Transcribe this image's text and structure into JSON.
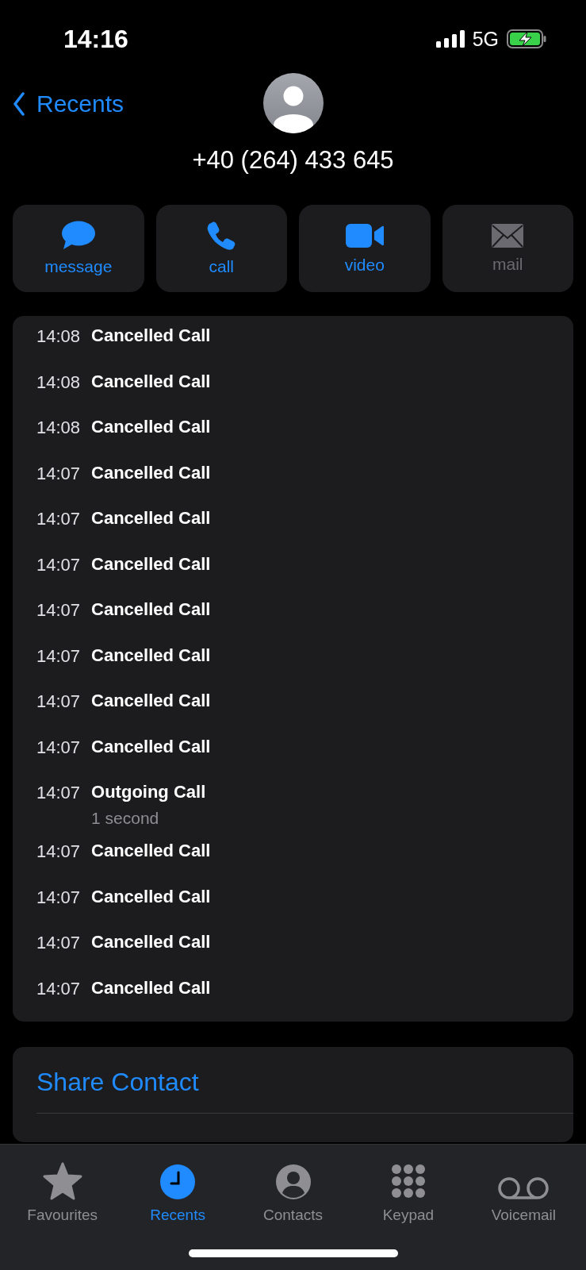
{
  "status_bar": {
    "time": "14:16",
    "network": "5G"
  },
  "nav": {
    "back": "Recents"
  },
  "contact": {
    "number": "+40 (264) 433 645"
  },
  "actions": [
    {
      "kind": "message",
      "label": "message",
      "disabled": false
    },
    {
      "kind": "call",
      "label": "call",
      "disabled": false
    },
    {
      "kind": "video",
      "label": "video",
      "disabled": false
    },
    {
      "kind": "mail",
      "label": "mail",
      "disabled": true
    }
  ],
  "calls": [
    {
      "time": "14:08",
      "type": "Cancelled Call"
    },
    {
      "time": "14:08",
      "type": "Cancelled Call"
    },
    {
      "time": "14:08",
      "type": "Cancelled Call"
    },
    {
      "time": "14:07",
      "type": "Cancelled Call"
    },
    {
      "time": "14:07",
      "type": "Cancelled Call"
    },
    {
      "time": "14:07",
      "type": "Cancelled Call"
    },
    {
      "time": "14:07",
      "type": "Cancelled Call"
    },
    {
      "time": "14:07",
      "type": "Cancelled Call"
    },
    {
      "time": "14:07",
      "type": "Cancelled Call"
    },
    {
      "time": "14:07",
      "type": "Cancelled Call"
    },
    {
      "time": "14:07",
      "type": "Outgoing Call",
      "duration": "1 second"
    },
    {
      "time": "14:07",
      "type": "Cancelled Call"
    },
    {
      "time": "14:07",
      "type": "Cancelled Call"
    },
    {
      "time": "14:07",
      "type": "Cancelled Call"
    },
    {
      "time": "14:07",
      "type": "Cancelled Call"
    }
  ],
  "options": [
    "Share Contact"
  ],
  "tabs": [
    {
      "kind": "favourites",
      "label": "Favourites",
      "selected": false
    },
    {
      "kind": "recents",
      "label": "Recents",
      "selected": true
    },
    {
      "kind": "contacts",
      "label": "Contacts",
      "selected": false
    },
    {
      "kind": "keypad",
      "label": "Keypad",
      "selected": false
    },
    {
      "kind": "voicemail",
      "label": "Voicemail",
      "selected": false
    }
  ]
}
